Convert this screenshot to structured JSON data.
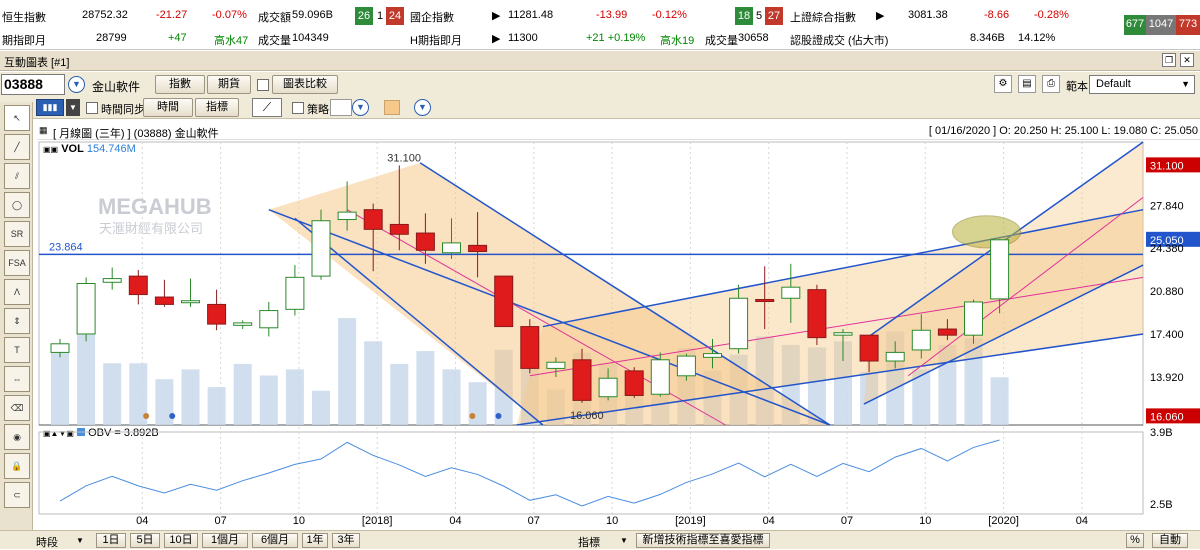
{
  "ticker": {
    "row1": [
      {
        "label": "恒生指數",
        "value": "28752.32",
        "chg": "-21.27",
        "pct": "-0.07%",
        "vol_label": "成交額",
        "vol": "59.096B"
      },
      {
        "label": "國企指數",
        "value": "11281.48",
        "chg": "-13.99",
        "pct": "-0.12%"
      },
      {
        "label": "上證綜合指數",
        "value": "3081.38",
        "chg": "-8.66",
        "pct": "-0.28%"
      }
    ],
    "row2": [
      {
        "label": "期指即月",
        "value": "28799",
        "chg": "+47",
        "extra": "高水47",
        "vol_label": "成交量",
        "vol": "104349"
      },
      {
        "label": "H期指即月",
        "value": "11300",
        "chg": "+21 +0.19%",
        "extra": "高水19",
        "vol_label": "成交量",
        "vol": "30658"
      },
      {
        "label": "認股證成交 (佔大市)",
        "value": "8.346B",
        "pct": "14.12%"
      }
    ],
    "badges1": [
      "26",
      "1",
      "24"
    ],
    "badges2": [
      "18",
      "5",
      "27"
    ],
    "badges3": [
      "677",
      "1047",
      "773"
    ]
  },
  "window": {
    "title": "互動圖表 [#1]"
  },
  "toolbar": {
    "code": "03888",
    "name": "金山軟件",
    "btn_index": "指數",
    "btn_futures": "期貨",
    "btn_compare": "圖表比較",
    "template_label": "範本",
    "template_value": "Default",
    "sync_label": "時間同步",
    "btn_time": "時間",
    "btn_indicator": "指標",
    "strategy_label": "策略"
  },
  "chart": {
    "header_left": "[ 月線圖 (三年) ]  (03888)  金山軟件",
    "header_right": "[ 01/16/2020 ]  O: 20.250  H: 25.100  L: 19.080  C: 25.050",
    "vol_label": "VOL",
    "vol_value": "154.746M",
    "obv_label": "OBV = 3.892B",
    "watermark1": "MEGAHUB",
    "watermark2": "天滙財經有限公司",
    "high_label": "31.100",
    "low_label": "16.060",
    "hline_label": "23.864",
    "price_axis": [
      "31.100",
      "27.840",
      "25.050",
      "24.380",
      "20.880",
      "17.400",
      "13.920",
      "16.060"
    ],
    "obv_axis": [
      "3.9B",
      "2.5B"
    ],
    "x_labels": [
      "04",
      "07",
      "10",
      "[2018]",
      "04",
      "07",
      "10",
      "[2019]",
      "04",
      "07",
      "10",
      "[2020]",
      "04"
    ]
  },
  "chart_data": {
    "type": "candlestick",
    "title": "[ 月線圖 (三年) ]  (03888)  金山軟件",
    "ohlc": [
      [
        15.9,
        17.0,
        15.5,
        16.6
      ],
      [
        17.4,
        22.0,
        16.8,
        21.5
      ],
      [
        21.6,
        22.8,
        21.0,
        21.9
      ],
      [
        22.1,
        22.6,
        19.8,
        20.6
      ],
      [
        20.4,
        21.8,
        19.6,
        19.8
      ],
      [
        20.0,
        21.9,
        19.6,
        20.1
      ],
      [
        19.8,
        21.0,
        17.7,
        18.2
      ],
      [
        18.1,
        18.5,
        17.8,
        18.3
      ],
      [
        17.9,
        20.0,
        17.2,
        19.3
      ],
      [
        19.4,
        23.0,
        18.9,
        22.0
      ],
      [
        22.1,
        27.5,
        21.8,
        26.6
      ],
      [
        26.7,
        29.8,
        25.8,
        27.3
      ],
      [
        27.5,
        28.0,
        22.5,
        25.9
      ],
      [
        26.3,
        31.1,
        24.2,
        25.5
      ],
      [
        25.6,
        27.2,
        23.1,
        24.2
      ],
      [
        24.0,
        26.8,
        23.5,
        24.8
      ],
      [
        24.6,
        27.3,
        22.0,
        24.1
      ],
      [
        22.1,
        22.0,
        19.8,
        18.0
      ],
      [
        18.0,
        18.6,
        14.2,
        14.6
      ],
      [
        14.6,
        15.5,
        13.9,
        15.1
      ],
      [
        15.3,
        16.2,
        11.8,
        12.0
      ],
      [
        12.3,
        14.6,
        12.0,
        13.8
      ],
      [
        14.4,
        14.7,
        12.2,
        12.4
      ],
      [
        12.5,
        15.9,
        12.3,
        15.3
      ],
      [
        14.0,
        15.8,
        13.6,
        15.6
      ],
      [
        15.5,
        17.0,
        14.6,
        15.8
      ],
      [
        16.2,
        21.4,
        15.8,
        20.3
      ],
      [
        20.2,
        22.9,
        17.8,
        20.1
      ],
      [
        20.3,
        23.1,
        18.3,
        21.2
      ],
      [
        21.0,
        21.4,
        16.5,
        17.1
      ],
      [
        17.3,
        17.8,
        15.2,
        17.5
      ],
      [
        17.3,
        17.3,
        14.3,
        15.2
      ],
      [
        15.2,
        16.8,
        14.6,
        15.9
      ],
      [
        16.1,
        19.0,
        15.4,
        17.7
      ],
      [
        17.8,
        18.6,
        16.9,
        17.3
      ],
      [
        17.3,
        20.2,
        16.6,
        20.0
      ],
      [
        20.25,
        25.1,
        19.08,
        25.05
      ]
    ],
    "volume": [
      125,
      160,
      101,
      101,
      75,
      91,
      62,
      100,
      81,
      91,
      56,
      175,
      137,
      100,
      121,
      91,
      70,
      123,
      149,
      58,
      118,
      101,
      70,
      91,
      126,
      89,
      115,
      145,
      131,
      127,
      137,
      87,
      153,
      91,
      131,
      142,
      78
    ],
    "ylim": [
      10.0,
      33.0
    ],
    "hlines": [
      23.864
    ],
    "x_ticks": [
      "04",
      "07",
      "10",
      "[2018]",
      "04",
      "07",
      "10",
      "[2019]",
      "04",
      "07",
      "10",
      "[2020]",
      "04"
    ]
  },
  "bottom": {
    "period_label": "時段",
    "periods": [
      "1日",
      "5日",
      "10日",
      "1個月",
      "6個月",
      "1年",
      "3年"
    ],
    "indicator_label": "指標",
    "add_label": "新增技術指標至喜愛指標",
    "pct_label": "%",
    "auto_label": "自動"
  },
  "colors": {
    "up": "#ffffff",
    "down": "#e01b1b",
    "trend": "#2255cc",
    "magenta": "#e0309a",
    "fill": "#f6c98a",
    "vol": "#c9d8ea"
  }
}
